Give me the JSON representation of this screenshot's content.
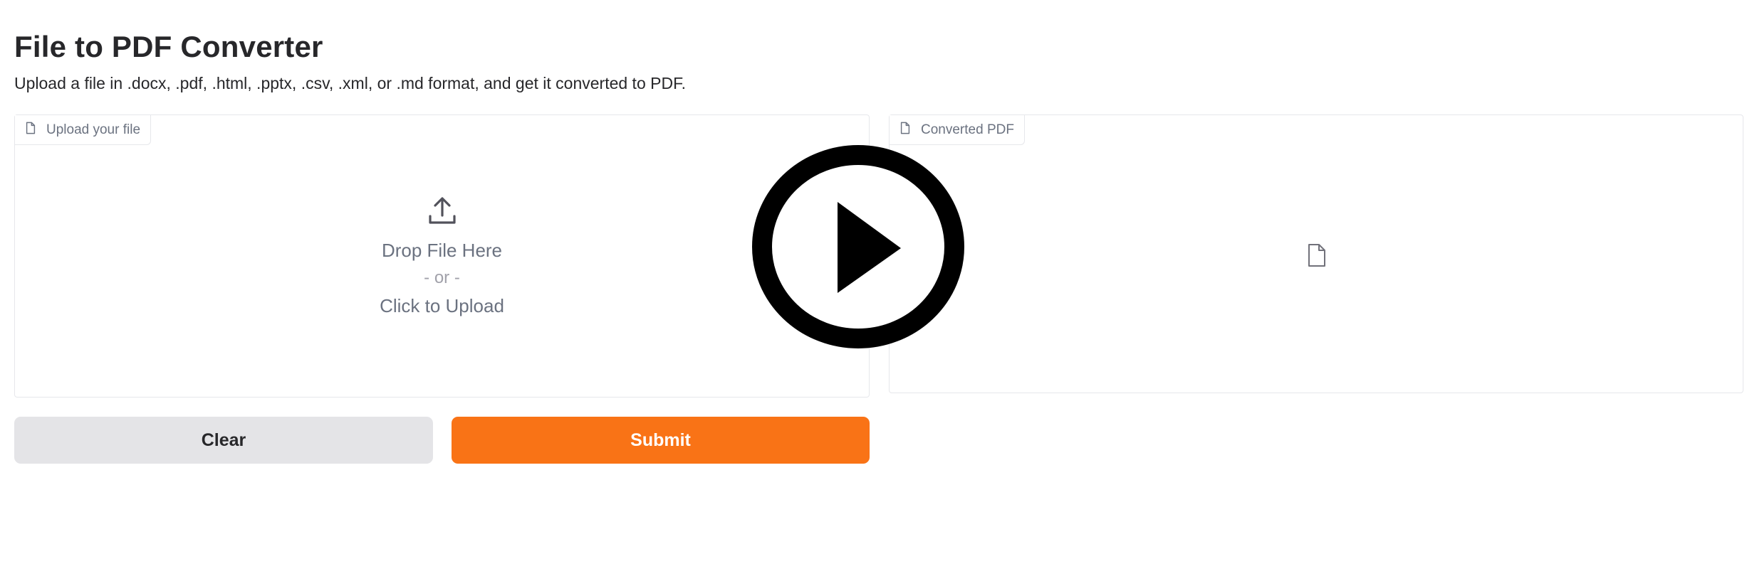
{
  "app": {
    "title": "File to PDF Converter",
    "description": "Upload a file in .docx, .pdf, .html, .pptx, .csv, .xml, or .md format, and get it converted to PDF."
  },
  "upload_panel": {
    "label": "Upload your file",
    "label_icon": "file-icon",
    "drop_icon": "upload-icon",
    "drop_text": "Drop File Here",
    "or_text": "- or -",
    "click_text": "Click to Upload"
  },
  "output_panel": {
    "label": "Converted PDF",
    "label_icon": "file-icon",
    "placeholder_icon": "file-icon"
  },
  "buttons": {
    "clear_label": "Clear",
    "submit_label": "Submit"
  },
  "overlay": {
    "icon": "play-icon"
  },
  "colors": {
    "accent": "#f97316",
    "secondary_button": "#e4e4e7",
    "text_primary": "#27272a",
    "text_muted": "#6b7280",
    "border": "#e6e7eb"
  }
}
